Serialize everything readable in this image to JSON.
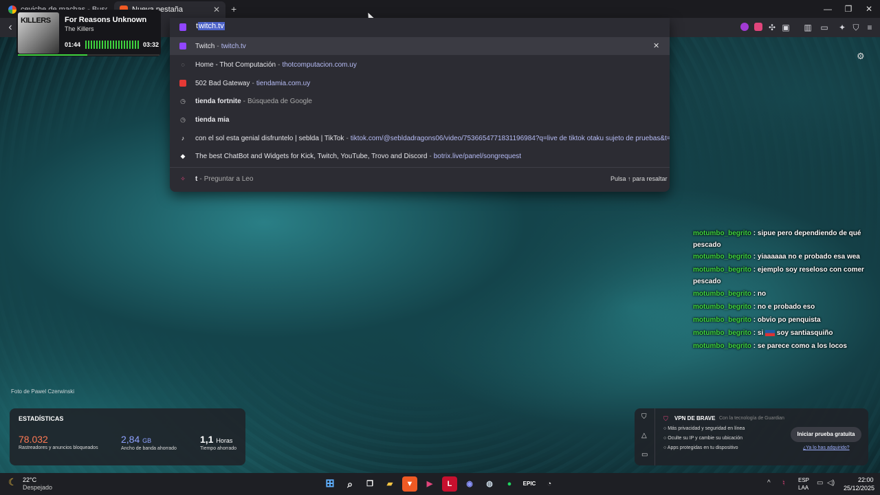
{
  "tabs": [
    {
      "title": "ceviche de machas - Buscar con Goo",
      "icon": "google-icon"
    },
    {
      "title": "Nueva pestaña",
      "icon": "brave-icon"
    }
  ],
  "address_bar": {
    "value_prefix": "t",
    "value_selected": "witch.tv"
  },
  "media": {
    "title": "For Reasons Unknown",
    "artist": "The Killers",
    "elapsed": "01:44",
    "total": "03:32",
    "art_text": "KILLERS",
    "progress": 0.49
  },
  "suggestions": [
    {
      "title": "Twitch",
      "sep": "-",
      "url": "twitch.tv",
      "icon": "twitch-icon"
    },
    {
      "title": "Home - Thot Computación",
      "sep": "-",
      "url": "thotcomputacion.com.uy",
      "icon": "globe-icon"
    },
    {
      "title": "502 Bad Gateway",
      "sep": "-",
      "url": "tiendamia.com.uy",
      "icon": "tiendamia-icon"
    },
    {
      "title": "tienda fortnite",
      "sep": "-",
      "gray": "Búsqueda de Google",
      "icon": "history-icon"
    },
    {
      "title": "tienda mia",
      "icon": "history-icon"
    },
    {
      "title": "con el sol esta genial disfruntelo | seblda | TikTok",
      "sep": "-",
      "url": "tiktok.com/@sebldadragons06/video/7536654771831196984?q=live de tiktok otaku  sujeto de pruebas&t=17592...",
      "icon": "tiktok-icon"
    },
    {
      "title": "The best ChatBot and Widgets for Kick, Twitch, YouTube, Trovo and Discord",
      "sep": "-",
      "url": "botrix.live/panel/songrequest",
      "icon": "botrix-icon"
    },
    {
      "title": "t",
      "sep": "-",
      "gray": "Preguntar a Leo",
      "icon": "leo-icon",
      "hint": "Pulsa ↑ para resaltar"
    }
  ],
  "photo_credit": "Foto de Pawel Czerwinski",
  "chat": [
    {
      "user": "motumbo_begrito",
      "msg": " : sipue pero dependiendo de qué pescado"
    },
    {
      "user": "motumbo_begrito",
      "msg": " : yiaaaaaa no e probado esa wea"
    },
    {
      "user": "motumbo_begrito",
      "msg": " : ejemplo soy reseloso con comer pescado"
    },
    {
      "user": "motumbo_begrito",
      "msg": " : no"
    },
    {
      "user": "motumbo_begrito",
      "msg": " : no e probado eso"
    },
    {
      "user": "motumbo_begrito",
      "msg": " : obvio po penquista"
    },
    {
      "user": "motumbo_begrito",
      "msg": " : si ",
      "msg2": " soy santiasquiño"
    },
    {
      "user": "motumbo_begrito",
      "msg": " : se parece como a los locos"
    }
  ],
  "stats": {
    "heading": "ESTADÍSTICAS",
    "blocked_value": "78.032",
    "blocked_label": "Rastreadores y anuncios bloqueados",
    "bandwidth_value": "2,84",
    "bandwidth_unit": "GB",
    "bandwidth_label": "Ancho de banda ahorrado",
    "time_value": "1,1",
    "time_unit": "Horas",
    "time_label": "Tiempo ahorrado"
  },
  "vpn": {
    "title": "VPN DE BRAVE",
    "powered": "Con la tecnología de Guardian",
    "features": [
      "Más privacidad y seguridad en línea",
      "Oculte su IP y cambie su ubicación",
      "Apps protegidas en tu dispositivo"
    ],
    "cta": "Iniciar prueba gratuita",
    "link": "¿Ya lo has adquirido?"
  },
  "taskbar": {
    "temp": "22°C",
    "weather": "Despejado",
    "lang": "ESP",
    "layout": "LAA",
    "time": "22:00",
    "date": "25/12/2025"
  },
  "colors": {
    "accent_selection": "#4d63c9",
    "chat_user": "#3fd63f",
    "vpn_button": "#3a3c44",
    "link": "#b6bcf5"
  }
}
